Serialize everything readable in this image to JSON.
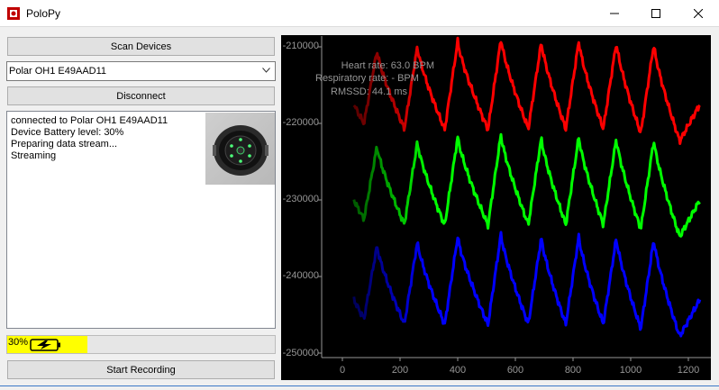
{
  "window": {
    "title": "PoloPy",
    "controls": [
      "minimize-icon",
      "maximize-icon",
      "close-icon"
    ]
  },
  "left_panel": {
    "scan_button": "Scan Devices",
    "device_select": {
      "selected": "Polar OH1 E49AAD11"
    },
    "disconnect_button": "Disconnect",
    "log_lines": [
      "connected to Polar OH1 E49AAD11",
      "Device Battery level: 30%",
      "Preparing data stream...",
      "Streaming"
    ],
    "battery": {
      "label": "30%",
      "level": 0.3,
      "fill_color": "#ffff00"
    },
    "start_button": "Start Recording"
  },
  "chart_data": {
    "type": "line",
    "ylim": [
      -251000,
      -209000
    ],
    "xlim": [
      -40,
      1260
    ],
    "yticks": [
      "-210000",
      "-220000",
      "-230000",
      "-240000",
      "-250000"
    ],
    "xticks": [
      "0",
      "200",
      "400",
      "600",
      "800",
      "1000",
      "1200"
    ],
    "stats": {
      "heart_rate": "Heart rate: 63.0 BPM",
      "respiratory_rate": "Respiratory rate: - BPM",
      "rmssd": "RMSSD: 44.1 ms"
    },
    "series": [
      {
        "color": "#ff0000",
        "offset": -215500
      },
      {
        "color": "#00ff00",
        "offset": -228000
      },
      {
        "color": "#0000ff",
        "offset": -241000
      }
    ],
    "pulse_peaks_x": [
      120,
      260,
      400,
      550,
      690,
      820,
      950,
      1080
    ],
    "pulse_peak_values": [
      5000,
      5500,
      6200,
      6500,
      6100,
      6200,
      6000,
      5800
    ],
    "pulse_trough_values": [
      -4500,
      -5200,
      -5300,
      -5300,
      -5200,
      -5200,
      -5200,
      -5800
    ],
    "background": "#000000",
    "axis_text_color": "#969696"
  }
}
